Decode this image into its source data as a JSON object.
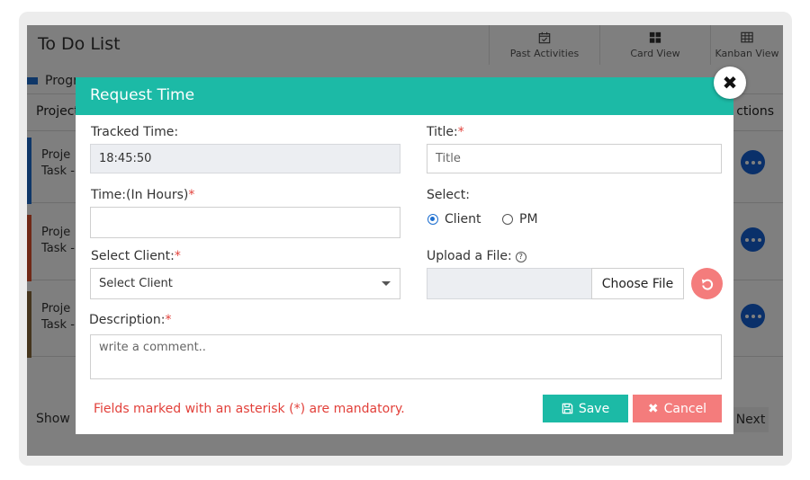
{
  "background_app": {
    "title": "To Do List",
    "nav": [
      {
        "label": "Past Activities",
        "icon": "calendar-check-icon"
      },
      {
        "label": "Card View",
        "icon": "grid-icon"
      },
      {
        "label": "Kanban View",
        "icon": "table-icon"
      }
    ],
    "legend_first": "Progr",
    "column_left": "Project",
    "column_right": "ctions",
    "rows": [
      {
        "line1": "Proje",
        "line2": "Task -",
        "bar_color": "#1f6fd1"
      },
      {
        "line1": "Proje",
        "line2": "Task -",
        "bar_color": "#e0502d"
      },
      {
        "line1": "Proje",
        "line2": "Task -",
        "bar_color": "#8a6a3a"
      }
    ],
    "show_label": "Show",
    "next_label": "Next"
  },
  "modal": {
    "title": "Request Time",
    "close_icon": "close-icon",
    "tracked_time_label": "Tracked Time:",
    "tracked_time_value": "18:45:50",
    "title_label": "Title:",
    "title_placeholder": "Title",
    "time_hours_label": "Time:(In Hours)",
    "select_label": "Select:",
    "radio_client": "Client",
    "radio_pm": "PM",
    "radio_selected": "Client",
    "select_client_label": "Select Client:",
    "select_client_value": "Select Client",
    "upload_label": "Upload a File:",
    "choose_file_label": "Choose File",
    "description_label": "Description:",
    "description_placeholder": "write a comment..",
    "required_mark": "*",
    "mandatory_note": "Fields marked with an asterisk (*) are mandatory.",
    "save_label": "Save",
    "cancel_label": "Cancel"
  },
  "colors": {
    "header_teal": "#1cbaa6",
    "required_red": "#e2403a",
    "cancel_salmon": "#f47c7c",
    "action_blue": "#1460d4"
  }
}
